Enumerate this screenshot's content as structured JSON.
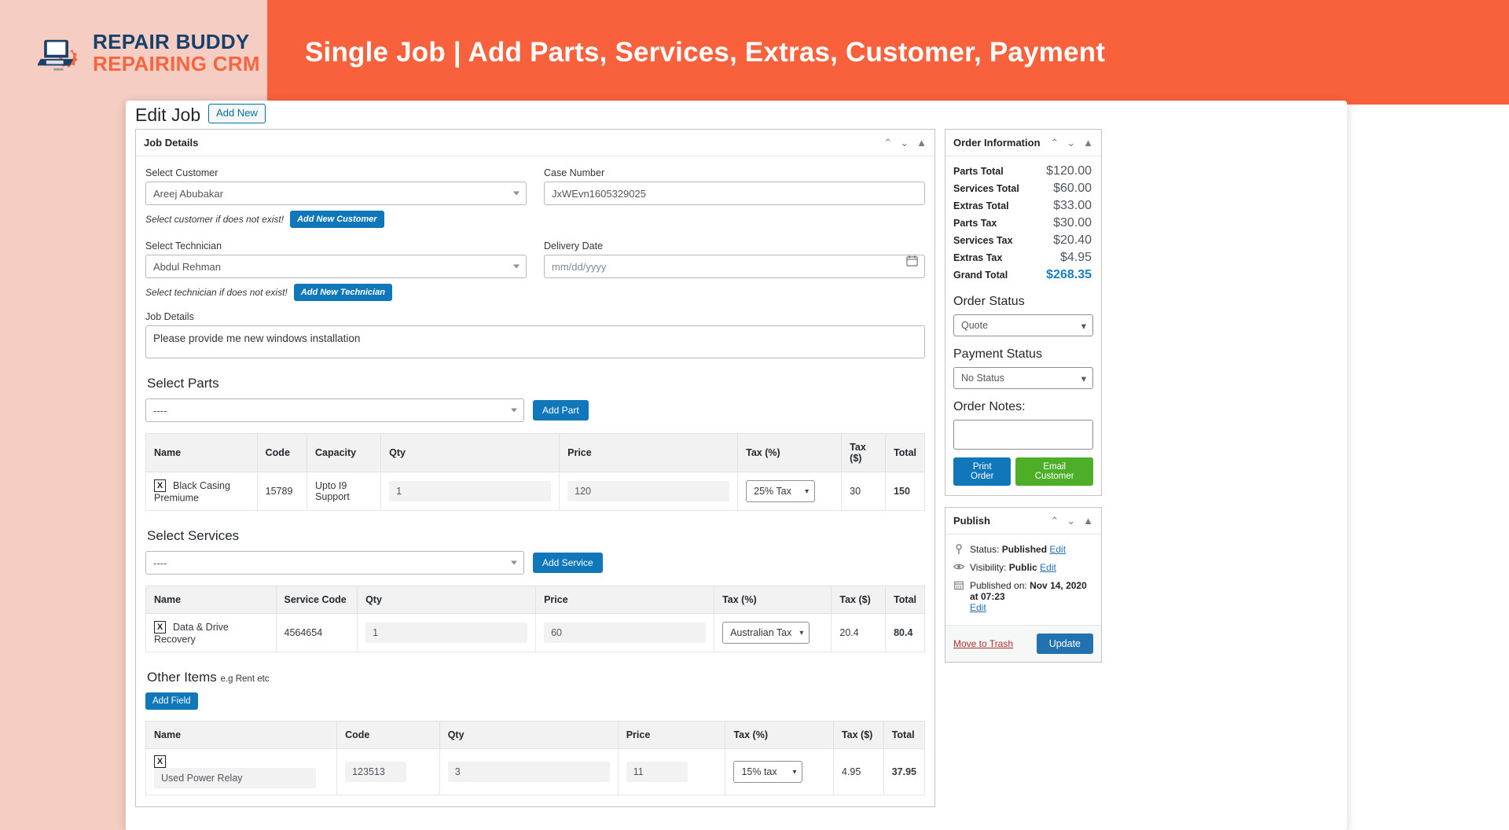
{
  "banner": {
    "logo_line1": "REPAIR BUDDY",
    "logo_line2": "REPAIRING CRM",
    "title": "Single Job | Add Parts, Services, Extras, Customer, Payment",
    "bg_color": "#f9613c",
    "left_bg_color": "#f6cdc2",
    "logo_navy": "#17406a",
    "logo_orange": "#f4663f"
  },
  "page": {
    "title": "Edit Job",
    "add_new_label": "Add New"
  },
  "job_details": {
    "panel_title": "Job Details",
    "customer_label": "Select Customer",
    "customer_value": "Areej Abubakar",
    "customer_hint": "Select customer if does not exist!",
    "add_customer_btn": "Add New Customer",
    "technician_label": "Select Technician",
    "technician_value": "Abdul Rehman",
    "technician_hint": "Select technician if does not exist!",
    "add_technician_btn": "Add New Technician",
    "case_number_label": "Case Number",
    "case_number_value": "JxWEvn1605329025",
    "delivery_date_label": "Delivery Date",
    "delivery_date_placeholder": "mm/dd/yyyy",
    "details_label": "Job Details",
    "details_value": "Please provide me new windows installation"
  },
  "parts": {
    "heading": "Select Parts",
    "picker_value": "----",
    "add_btn": "Add Part",
    "columns": [
      "Name",
      "Code",
      "Capacity",
      "Qty",
      "Price",
      "Tax (%)",
      "Tax ($)",
      "Total"
    ],
    "rows": [
      {
        "remove": "X",
        "name": "Black Casing Premiume",
        "code": "15789",
        "capacity": "Upto I9 Support",
        "qty": "1",
        "price": "120",
        "tax_pct": "25% Tax",
        "tax_amt": "30",
        "total": "150"
      }
    ]
  },
  "services": {
    "heading": "Select Services",
    "picker_value": "----",
    "add_btn": "Add Service",
    "columns": [
      "Name",
      "Service Code",
      "Qty",
      "Price",
      "Tax (%)",
      "Tax ($)",
      "Total"
    ],
    "rows": [
      {
        "remove": "X",
        "name": "Data & Drive Recovery",
        "code": "4564654",
        "qty": "1",
        "price": "60",
        "tax_pct": "Australian Tax",
        "tax_amt": "20.4",
        "total": "80.4"
      }
    ]
  },
  "extras": {
    "heading": "Other Items",
    "heading_sub": "e.g Rent etc",
    "add_field_btn": "Add Field",
    "columns": [
      "Name",
      "Code",
      "Qty",
      "Price",
      "Tax (%)",
      "Tax ($)",
      "Total"
    ],
    "rows": [
      {
        "remove": "X",
        "name": "Used Power Relay",
        "code": "123513",
        "qty": "3",
        "price": "11",
        "tax_pct": "15% tax",
        "tax_amt": "4.95",
        "total": "37.95"
      }
    ]
  },
  "order_information": {
    "panel_title": "Order Information",
    "lines": [
      {
        "label": "Parts Total",
        "value": "$120.00"
      },
      {
        "label": "Services Total",
        "value": "$60.00"
      },
      {
        "label": "Extras Total",
        "value": "$33.00"
      },
      {
        "label": "Parts Tax",
        "value": "$30.00"
      },
      {
        "label": "Services Tax",
        "value": "$20.40"
      },
      {
        "label": "Extras Tax",
        "value": "$4.95"
      }
    ],
    "grand_total_label": "Grand Total",
    "grand_total_value": "$268.35",
    "grand_total_color": "#1a7fc1",
    "order_status_label": "Order Status",
    "order_status_value": "Quote",
    "payment_status_label": "Payment Status",
    "payment_status_value": "No Status",
    "order_notes_label": "Order Notes:",
    "order_notes_value": "",
    "print_order_btn": "Print Order",
    "email_customer_btn": "Email Customer",
    "email_btn_color": "#4caf27",
    "print_btn_color": "#0f77ba"
  },
  "publish": {
    "panel_title": "Publish",
    "status_text": "Status: ",
    "status_value": "Published",
    "status_edit": "Edit",
    "visibility_text": "Visibility: ",
    "visibility_value": "Public",
    "visibility_edit": "Edit",
    "published_text": "Published on: ",
    "published_value": "Nov 14, 2020 at 07:23",
    "published_edit": "Edit",
    "move_to_trash": "Move to Trash",
    "update_btn": "Update"
  },
  "icons": {
    "chevron_up": "⌃",
    "chevron_down": "⌄",
    "triangle_up": "▲",
    "calendar": "🗓",
    "pin": "📌",
    "eye": "👁",
    "cal2": "📅"
  }
}
